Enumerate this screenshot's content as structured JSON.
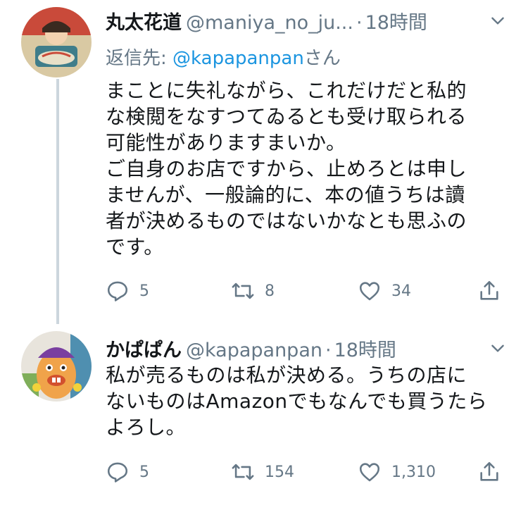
{
  "tweets": [
    {
      "display_name": "丸太花道",
      "handle": "@maniya_no_ju...",
      "time": "18時間",
      "reply_prefix": "返信先: ",
      "reply_mention": "@kapapanpan",
      "reply_suffix": "さん",
      "text": "まことに失礼ながら、これだけだと私的\nな検閲をなすつてゐるとも受け取られる\n可能性がありますまいか。\nご自身のお店ですから、止めろとは申し\nませんが、一般論的に、本の値うちは讀\n者が決めるものではないかなとも思ふの\nです。",
      "replies": "5",
      "retweets": "8",
      "likes": "34"
    },
    {
      "display_name": "かぱぱん",
      "handle": "@kapapanpan",
      "time": "18時間",
      "text": "私が売るものは私が決める。うちの店に\nないものはAmazonでもなんでも買うたら\nよろし。",
      "replies": "5",
      "retweets": "154",
      "likes": "1,310"
    }
  ],
  "colors": {
    "text": "#14171a",
    "secondary": "#657786",
    "link": "#1b95e0",
    "thread_line": "#ccd6dd"
  },
  "icons": [
    "reply-icon",
    "retweet-icon",
    "like-icon",
    "share-icon",
    "chevron-down-icon"
  ]
}
